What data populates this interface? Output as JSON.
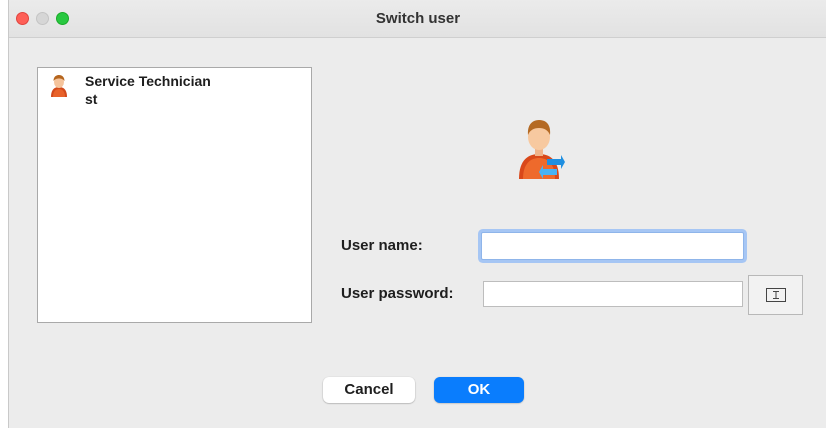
{
  "window": {
    "title": "Switch user"
  },
  "user_list": {
    "items": [
      {
        "name": "Service Technician",
        "id": "st",
        "icon": "user-avatar-icon"
      }
    ]
  },
  "form": {
    "user_name_label": "User name:",
    "user_name_value": "",
    "user_password_label": "User password:",
    "user_password_value": "",
    "keyboard_icon": "text-cursor-icon"
  },
  "buttons": {
    "cancel_label": "Cancel",
    "ok_label": "OK"
  },
  "colors": {
    "accent": "#0a7dfd",
    "focus_ring": "#a6c6f4",
    "close": "#fe5f57",
    "maximize": "#28c840"
  }
}
